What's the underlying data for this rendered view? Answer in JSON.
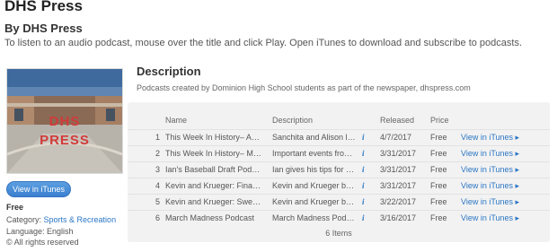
{
  "page": {
    "title": "DHS Press",
    "byline": "By DHS Press",
    "subtitle": "To listen to an audio podcast, mouse over the title and click Play. Open iTunes to download and subscribe to podcasts."
  },
  "sidebar": {
    "artwork_text": "DHS\nPRESS",
    "artwork_line1": "DHS",
    "artwork_line2": "PRESS",
    "view_button": "View in iTunes",
    "price": "Free",
    "category_label": "Category: ",
    "category_value": "Sports & Recreation",
    "language": "Language: English",
    "rights": "© All rights reserved"
  },
  "description": {
    "heading": "Description",
    "text": "Podcasts created by Dominion High School students as part of the newspaper, dhspress.com"
  },
  "table": {
    "columns": [
      "Name",
      "Description",
      "Released",
      "Price"
    ],
    "rows": [
      {
        "num": "1",
        "name": "This Week In History– Apr...",
        "desc": "Sanchita and Alison loo...",
        "released": "4/7/2017",
        "price": "Free",
        "view": "View in iTunes ▸"
      },
      {
        "num": "2",
        "name": "This Week In History– Mar...",
        "desc": "Important events from ...",
        "released": "3/31/2017",
        "price": "Free",
        "view": "View in iTunes ▸"
      },
      {
        "num": "3",
        "name": "Ian's Baseball Draft Podcast",
        "desc": "Ian gives his tips for yo...",
        "released": "3/31/2017",
        "price": "Free",
        "view": "View in iTunes ▸"
      },
      {
        "num": "4",
        "name": "Kevin and Krueger: Final F...",
        "desc": "Kevin and Krueger bre...",
        "released": "3/31/2017",
        "price": "Free",
        "view": "View in iTunes ▸"
      },
      {
        "num": "5",
        "name": "Kevin and Krueger: Sweet ...",
        "desc": "Kevin and Krueger bre...",
        "released": "3/22/2017",
        "price": "Free",
        "view": "View in iTunes ▸"
      },
      {
        "num": "6",
        "name": "March Madness Podcast",
        "desc": "March Madness Podcas...",
        "released": "3/16/2017",
        "price": "Free",
        "view": "View in iTunes ▸"
      }
    ],
    "info_icon": "i",
    "footer": "6 Items"
  },
  "colors": {
    "link": "#2b76c4",
    "button": "#3b7fd0",
    "table_bg": "#f2f2f2",
    "artwork_text": "#d23a3a"
  }
}
